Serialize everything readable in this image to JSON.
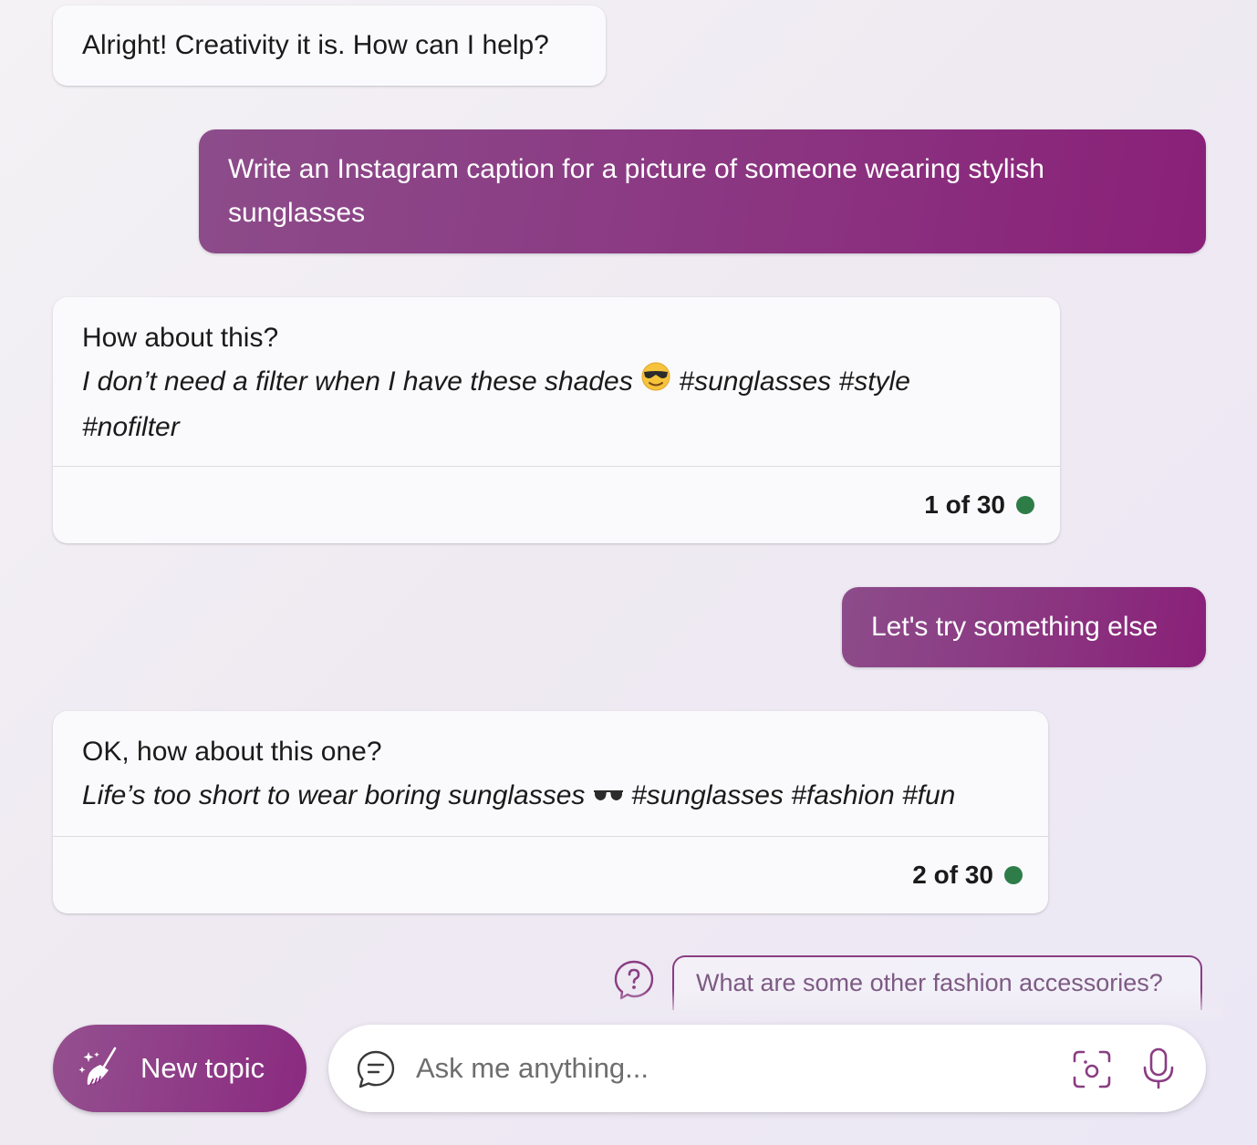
{
  "colors": {
    "accent_start": "#8c4c8a",
    "accent_end": "#8a2078",
    "status_green": "#2e7d48",
    "bot_bubble": "#fafafc"
  },
  "conversation": {
    "msg1": {
      "role": "bot",
      "text": "Alright! Creativity it is. How can I help?"
    },
    "msg2": {
      "role": "user",
      "text": "Write an Instagram caption for a picture of someone wearing stylish sunglasses"
    },
    "msg3": {
      "role": "bot",
      "intro": "How about this?",
      "caption_before_emoji": "I don’t need a filter when I have these shades ",
      "emoji": "smiling-face-with-sunglasses-icon",
      "caption_after_emoji": " #sunglasses #style #nofilter",
      "counter": "1 of 30"
    },
    "msg4": {
      "role": "user",
      "text": "Let's try something else"
    },
    "msg5": {
      "role": "bot",
      "intro": "OK, how about this one?",
      "caption_before_emoji": "Life’s too short to wear boring sunglasses ",
      "emoji": "dark-sunglasses-icon",
      "caption_after_emoji": " #sunglasses #fashion #fun",
      "counter": "2 of 30"
    }
  },
  "suggestions": {
    "icon": "question-bubble-icon",
    "items": [
      "What are some other fashion accessories?"
    ]
  },
  "bottom_bar": {
    "new_topic_icon": "broom-sparkle-icon",
    "new_topic_label": "New topic",
    "chat_icon": "chat-bubble-icon",
    "input_placeholder": "Ask me anything...",
    "input_value": "",
    "camera_icon": "visual-search-icon",
    "mic_icon": "microphone-icon"
  }
}
